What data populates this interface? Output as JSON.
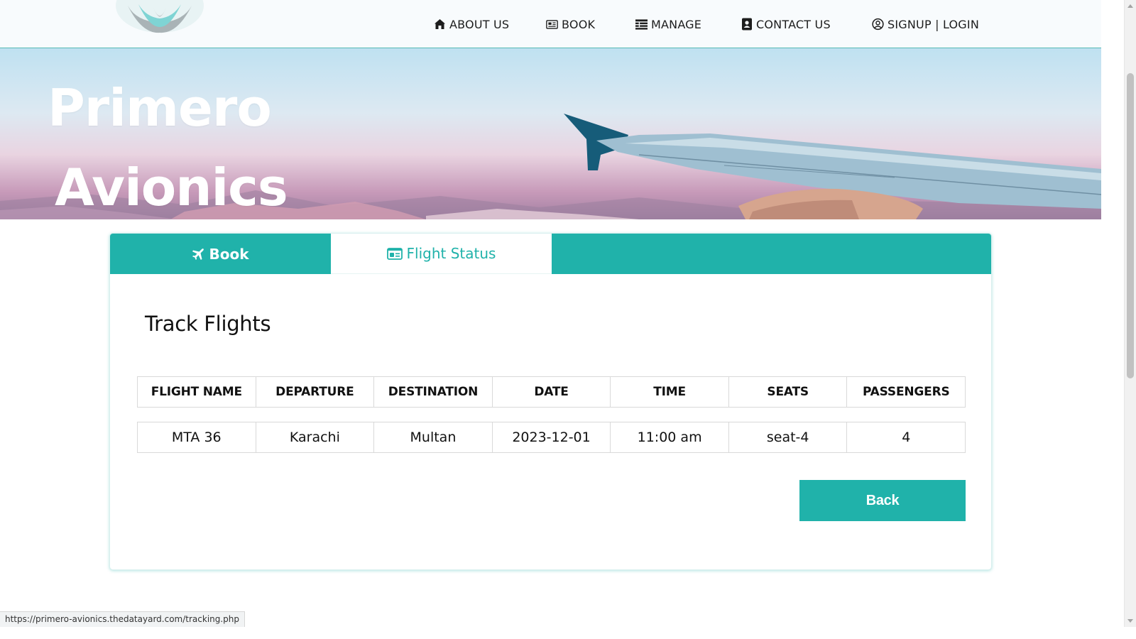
{
  "nav": {
    "items": [
      {
        "label": "ABOUT US",
        "icon": "home-icon"
      },
      {
        "label": "BOOK",
        "icon": "newspaper-icon"
      },
      {
        "label": "MANAGE",
        "icon": "list-icon"
      },
      {
        "label": "CONTACT US",
        "icon": "address-book-icon"
      },
      {
        "label": "SIGNUP | LOGIN",
        "icon": "user-circle-icon"
      }
    ]
  },
  "hero": {
    "brand_line1": "Primero",
    "brand_line2": "Avionics"
  },
  "tabs": [
    {
      "label": "Book",
      "icon": "plane-icon",
      "active": false
    },
    {
      "label": "Flight Status",
      "icon": "id-card-icon",
      "active": true
    }
  ],
  "main": {
    "title": "Track Flights",
    "table": {
      "headers": [
        "FLIGHT NAME",
        "DEPARTURE",
        "DESTINATION",
        "DATE",
        "TIME",
        "SEATS",
        "PASSENGERS"
      ],
      "rows": [
        [
          "MTA 36",
          "Karachi",
          "Multan",
          "2023-12-01",
          "11:00 am",
          "seat-4",
          "4"
        ]
      ]
    },
    "back_label": "Back"
  },
  "status_bar": {
    "url": "https://primero-avionics.thedatayard.com/tracking.php"
  },
  "colors": {
    "accent": "#20b2aa",
    "nav_bg": "#f8fbfd",
    "text": "#111111"
  }
}
